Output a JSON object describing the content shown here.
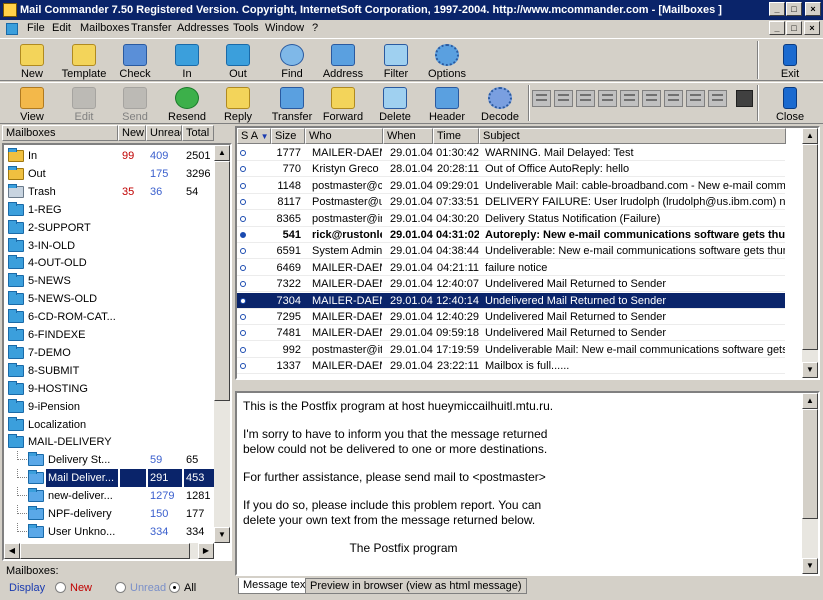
{
  "window": {
    "title": "Mail Commander 7.50  Registered Version. Copyright, InternetSoft Corporation, 1997-2004. http://www.mcommander.com  - [Mailboxes ]",
    "controls": {
      "minimize": "_",
      "maximize": "□",
      "close": "×"
    }
  },
  "menu": [
    "File",
    "Edit",
    "Mailboxes",
    "Transfer",
    "Addresses",
    "Tools",
    "Window",
    "?"
  ],
  "toolbar1": [
    {
      "label": "New",
      "icon": "new-mail-icon"
    },
    {
      "label": "Template",
      "icon": "template-icon"
    },
    {
      "label": "Check",
      "icon": "check-icon"
    },
    {
      "label": "In",
      "icon": "in-icon"
    },
    {
      "label": "Out",
      "icon": "out-icon"
    },
    {
      "label": "Find",
      "icon": "find-icon"
    },
    {
      "label": "Address",
      "icon": "address-icon"
    },
    {
      "label": "Filter",
      "icon": "filter-icon"
    },
    {
      "label": "Options",
      "icon": "options-icon"
    },
    {
      "label": "Exit",
      "icon": "exit-icon"
    }
  ],
  "toolbar2": [
    {
      "label": "View",
      "icon": "view-icon",
      "enabled": true
    },
    {
      "label": "Edit",
      "icon": "edit-icon",
      "enabled": false
    },
    {
      "label": "Send",
      "icon": "send-icon",
      "enabled": false
    },
    {
      "label": "Resend",
      "icon": "resend-icon",
      "enabled": true
    },
    {
      "label": "Reply",
      "icon": "reply-icon",
      "enabled": true
    },
    {
      "label": "Transfer",
      "icon": "transfer-icon",
      "enabled": true
    },
    {
      "label": "Forward",
      "icon": "forward-icon",
      "enabled": true
    },
    {
      "label": "Delete",
      "icon": "delete-icon",
      "enabled": true
    },
    {
      "label": "Header",
      "icon": "header-icon",
      "enabled": true
    },
    {
      "label": "Decode",
      "icon": "decode-icon",
      "enabled": true
    },
    {
      "label": "Close",
      "icon": "close-icon",
      "enabled": true
    }
  ],
  "mailbox_panel": {
    "headers": {
      "name": "Mailboxes",
      "new": "New",
      "unread": "Unread",
      "total": "Total"
    },
    "folders": [
      {
        "name": "In",
        "new": "99",
        "unread": "409",
        "total": "2501",
        "icon": "inbox-icon"
      },
      {
        "name": "Out",
        "new": "",
        "unread": "175",
        "total": "3296",
        "icon": "outbox-icon"
      },
      {
        "name": "Trash",
        "new": "35",
        "unread": "36",
        "total": "54",
        "icon": "trash-icon"
      },
      {
        "name": "1-REG",
        "new": "",
        "unread": "",
        "total": "",
        "icon": "folder-icon"
      },
      {
        "name": "2-SUPPORT",
        "new": "",
        "unread": "",
        "total": "",
        "icon": "folder-icon"
      },
      {
        "name": "3-IN-OLD",
        "new": "",
        "unread": "",
        "total": "",
        "icon": "folder-icon"
      },
      {
        "name": "4-OUT-OLD",
        "new": "",
        "unread": "",
        "total": "",
        "icon": "folder-icon"
      },
      {
        "name": "5-NEWS",
        "new": "",
        "unread": "",
        "total": "",
        "icon": "folder-icon"
      },
      {
        "name": "5-NEWS-OLD",
        "new": "",
        "unread": "",
        "total": "",
        "icon": "folder-icon"
      },
      {
        "name": "6-CD-ROM-CAT...",
        "new": "",
        "unread": "",
        "total": "",
        "icon": "folder-icon"
      },
      {
        "name": "6-FINDEXE",
        "new": "",
        "unread": "",
        "total": "",
        "icon": "folder-icon"
      },
      {
        "name": "7-DEMO",
        "new": "",
        "unread": "",
        "total": "",
        "icon": "folder-icon"
      },
      {
        "name": "8-SUBMIT",
        "new": "",
        "unread": "",
        "total": "",
        "icon": "folder-icon"
      },
      {
        "name": "9-HOSTING",
        "new": "",
        "unread": "",
        "total": "",
        "icon": "folder-icon"
      },
      {
        "name": "9-iPension",
        "new": "",
        "unread": "",
        "total": "",
        "icon": "folder-icon"
      },
      {
        "name": "Localization",
        "new": "",
        "unread": "",
        "total": "",
        "icon": "folder-icon"
      },
      {
        "name": "MAIL-DELIVERY",
        "new": "",
        "unread": "",
        "total": "",
        "icon": "folder-icon"
      },
      {
        "name": "Delivery St...",
        "new": "",
        "unread": "59",
        "total": "65",
        "icon": "mailbox-icon",
        "child": true
      },
      {
        "name": "Mail Deliver...",
        "new": "",
        "unread": "291",
        "total": "453",
        "icon": "mailbox-icon",
        "child": true,
        "selected": true
      },
      {
        "name": "new-deliver...",
        "new": "",
        "unread": "1279",
        "total": "1281",
        "icon": "mailbox-icon",
        "child": true
      },
      {
        "name": "NPF-delivery",
        "new": "",
        "unread": "150",
        "total": "177",
        "icon": "mailbox-icon",
        "child": true
      },
      {
        "name": "User Unkno...",
        "new": "",
        "unread": "334",
        "total": "334",
        "icon": "mailbox-icon",
        "child": true
      }
    ],
    "footer_label": "Mailboxes:",
    "display_label": "Display",
    "filters": [
      {
        "label": "New",
        "checked": false
      },
      {
        "label": "Unread",
        "checked": false
      },
      {
        "label": "All",
        "checked": true
      }
    ]
  },
  "message_list": {
    "headers": {
      "sa": "S A",
      "size": "Size",
      "who": "Who",
      "when": "When",
      "time": "Time",
      "subject": "Subject"
    },
    "rows": [
      {
        "size": "1777",
        "who": "MAILER-DAEMC",
        "when": "29.01.04",
        "time": "01:30:42",
        "subject": "WARNING. Mail Delayed: Test",
        "bold": false,
        "selected": false,
        "status": "open"
      },
      {
        "size": "770",
        "who": "Kristyn Greco <",
        "when": "28.01.04",
        "time": "20:28:11",
        "subject": "Out of Office AutoReply: hello",
        "bold": false,
        "selected": false,
        "status": "open"
      },
      {
        "size": "1148",
        "who": "postmaster@ca",
        "when": "29.01.04",
        "time": "09:29:01",
        "subject": "Undeliverable Mail: cable-broadband.com - New e-mail communication",
        "bold": false,
        "selected": false,
        "status": "open"
      },
      {
        "size": "8117",
        "who": "Postmaster@us",
        "when": "29.01.04",
        "time": "07:33:51",
        "subject": "DELIVERY FAILURE: User lrudolph (lrudolph@us.ibm.com) not listed in",
        "bold": false,
        "selected": false,
        "status": "open"
      },
      {
        "size": "8365",
        "who": "postmaster@int",
        "when": "29.01.04",
        "time": "04:30:20",
        "subject": "Delivery Status Notification (Failure)",
        "bold": false,
        "selected": false,
        "status": "open"
      },
      {
        "size": "541",
        "who": "rick@rustonle",
        "when": "29.01.04",
        "time": "04:31:02",
        "subject": "Autoreply: New e-mail communications software gets thumbs",
        "bold": true,
        "selected": false,
        "status": "full"
      },
      {
        "size": "6591",
        "who": "System Adminis",
        "when": "29.01.04",
        "time": "04:38:44",
        "subject": "Undeliverable: New e-mail communications software gets thumbs up",
        "bold": false,
        "selected": false,
        "status": "open"
      },
      {
        "size": "6469",
        "who": "MAILER-DAEMC",
        "when": "29.01.04",
        "time": "04:21:11",
        "subject": "failure notice",
        "bold": false,
        "selected": false,
        "status": "open"
      },
      {
        "size": "7322",
        "who": "MAILER-DAEMC",
        "when": "29.01.04",
        "time": "12:40:07",
        "subject": "Undelivered Mail Returned to Sender",
        "bold": false,
        "selected": false,
        "status": "open"
      },
      {
        "size": "7304",
        "who": "MAILER-DAEMC",
        "when": "29.01.04",
        "time": "12:40:14",
        "subject": "Undelivered Mail Returned to Sender",
        "bold": false,
        "selected": true,
        "status": "open"
      },
      {
        "size": "7295",
        "who": "MAILER-DAEMC",
        "when": "29.01.04",
        "time": "12:40:29",
        "subject": "Undelivered Mail Returned to Sender",
        "bold": false,
        "selected": false,
        "status": "open"
      },
      {
        "size": "7481",
        "who": "MAILER-DAEMC",
        "when": "29.01.04",
        "time": "09:59:18",
        "subject": "Undelivered Mail Returned to Sender",
        "bold": false,
        "selected": false,
        "status": "open"
      },
      {
        "size": "992",
        "who": "postmaster@iti.",
        "when": "29.01.04",
        "time": "17:19:59",
        "subject": "Undeliverable Mail: New e-mail communications software gets thumbs",
        "bold": false,
        "selected": false,
        "status": "open"
      },
      {
        "size": "1337",
        "who": "MAILER-DAEMC",
        "when": "29.01.04",
        "time": "23:22:11",
        "subject": "Mailbox is full......",
        "bold": false,
        "selected": false,
        "status": "open"
      }
    ]
  },
  "preview": {
    "lines": [
      "This is the Postfix program at host hueymiccailhuitl.mtu.ru.",
      "",
      "I'm sorry to have to inform you that the message returned",
      "below could not be delivered to one or more destinations.",
      "",
      "For further assistance, please send mail to <postmaster>",
      "",
      "If you do so, please include this problem report. You can",
      "delete your own text from the message returned below.",
      "",
      "                                The Postfix program"
    ],
    "tabs": [
      "Message text",
      "Preview in browser (view as html message)"
    ]
  },
  "colors": {
    "title_bg": "#0a246a",
    "selection": "#0a246a",
    "new_count": "#c00000",
    "unread_count": "#3a5fcd"
  }
}
